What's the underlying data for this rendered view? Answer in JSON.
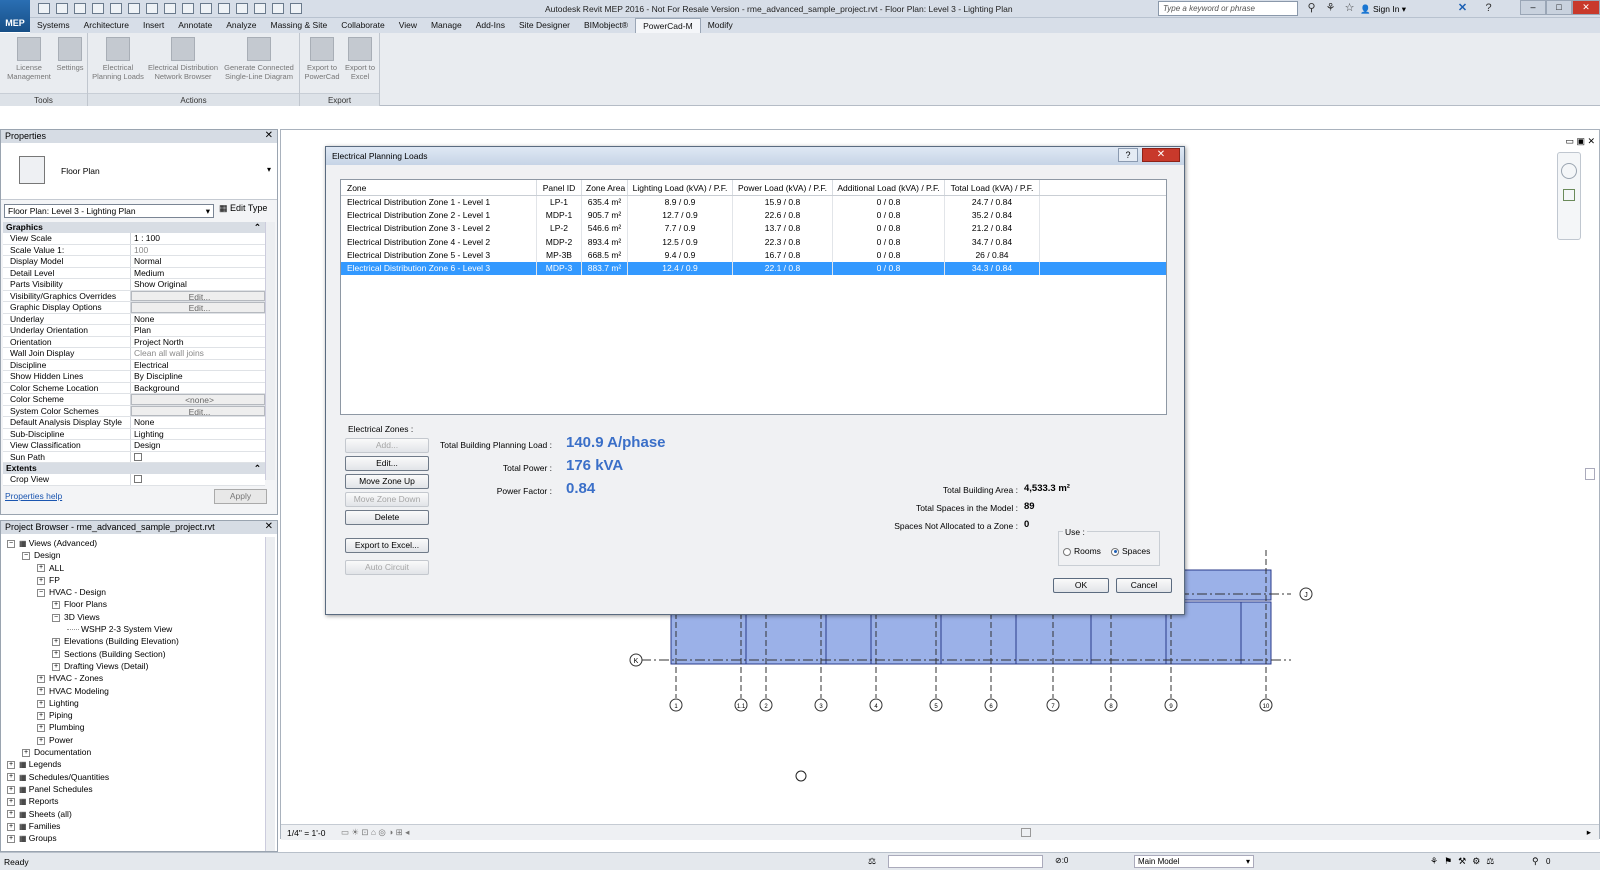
{
  "app": {
    "logo_label": "MEP",
    "title": "Autodesk Revit MEP 2016 - Not For Resale Version -     rme_advanced_sample_project.rvt - Floor Plan: Level 3 - Lighting Plan",
    "search_placeholder": "Type a keyword or phrase",
    "sign_in": "Sign In"
  },
  "tabs": [
    "Systems",
    "Architecture",
    "Insert",
    "Annotate",
    "Analyze",
    "Massing & Site",
    "Collaborate",
    "View",
    "Manage",
    "Add-Ins",
    "Site Designer",
    "BIMobject®",
    "PowerCad-M",
    "Modify"
  ],
  "active_tab": "PowerCad-M",
  "ribbon": {
    "panels": [
      {
        "label": "Tools",
        "buttons": [
          "License\nManagement",
          "Settings"
        ]
      },
      {
        "label": "Actions",
        "buttons": [
          "Electrical\nPlanning Loads",
          "Electrical Distribution\nNetwork Browser",
          "Generate Connected\nSingle-Line Diagram"
        ]
      },
      {
        "label": "Export",
        "buttons": [
          "Export to\nPowerCad",
          "Export to\nExcel"
        ]
      }
    ]
  },
  "properties": {
    "header": "Properties",
    "type_name": "Floor Plan",
    "view_selector": "Floor Plan: Level 3 - Lighting Plan",
    "edit_type": "Edit Type",
    "section_graphics": "Graphics",
    "rows": [
      {
        "k": "View Scale",
        "v": "1 : 100",
        "style": ""
      },
      {
        "k": "Scale Value   1:",
        "v": "100",
        "style": "dim"
      },
      {
        "k": "Display Model",
        "v": "Normal",
        "style": ""
      },
      {
        "k": "Detail Level",
        "v": "Medium",
        "style": ""
      },
      {
        "k": "Parts Visibility",
        "v": "Show Original",
        "style": ""
      },
      {
        "k": "Visibility/Graphics Overrides",
        "v": "Edit...",
        "style": "btn"
      },
      {
        "k": "Graphic Display Options",
        "v": "Edit...",
        "style": "btn"
      },
      {
        "k": "Underlay",
        "v": "None",
        "style": ""
      },
      {
        "k": "Underlay Orientation",
        "v": "Plan",
        "style": ""
      },
      {
        "k": "Orientation",
        "v": "Project North",
        "style": ""
      },
      {
        "k": "Wall Join Display",
        "v": "Clean all wall joins",
        "style": "dim"
      },
      {
        "k": "Discipline",
        "v": "Electrical",
        "style": ""
      },
      {
        "k": "Show Hidden Lines",
        "v": "By Discipline",
        "style": ""
      },
      {
        "k": "Color Scheme Location",
        "v": "Background",
        "style": ""
      },
      {
        "k": "Color Scheme",
        "v": "<none>",
        "style": "btn"
      },
      {
        "k": "System Color Schemes",
        "v": "Edit...",
        "style": "btn"
      },
      {
        "k": "Default Analysis Display Style",
        "v": "None",
        "style": ""
      },
      {
        "k": "Sub-Discipline",
        "v": "Lighting",
        "style": ""
      },
      {
        "k": "View Classification",
        "v": "Design",
        "style": ""
      },
      {
        "k": "Sun Path",
        "v": "",
        "style": "check"
      }
    ],
    "section_extents": "Extents",
    "extent_rows": [
      {
        "k": "Crop View",
        "v": "",
        "style": "check"
      }
    ],
    "help": "Properties help",
    "apply": "Apply"
  },
  "browser": {
    "header": "Project Browser - rme_advanced_sample_project.rvt",
    "items": [
      {
        "label": "Views (Advanced)",
        "level": 0,
        "exp": "-"
      },
      {
        "label": "Design",
        "level": 1,
        "exp": "-"
      },
      {
        "label": "ALL",
        "level": 2,
        "exp": "+"
      },
      {
        "label": "FP",
        "level": 2,
        "exp": "+"
      },
      {
        "label": "HVAC - Design",
        "level": 2,
        "exp": "-"
      },
      {
        "label": "Floor Plans",
        "level": 3,
        "exp": "+"
      },
      {
        "label": "3D Views",
        "level": 3,
        "exp": "-"
      },
      {
        "label": "WSHP 2-3 System View",
        "level": 4,
        "exp": ""
      },
      {
        "label": "Elevations (Building Elevation)",
        "level": 3,
        "exp": "+"
      },
      {
        "label": "Sections (Building Section)",
        "level": 3,
        "exp": "+"
      },
      {
        "label": "Drafting Views (Detail)",
        "level": 3,
        "exp": "+"
      },
      {
        "label": "HVAC - Zones",
        "level": 2,
        "exp": "+"
      },
      {
        "label": "HVAC Modeling",
        "level": 2,
        "exp": "+"
      },
      {
        "label": "Lighting",
        "level": 2,
        "exp": "+"
      },
      {
        "label": "Piping",
        "level": 2,
        "exp": "+"
      },
      {
        "label": "Plumbing",
        "level": 2,
        "exp": "+"
      },
      {
        "label": "Power",
        "level": 2,
        "exp": "+"
      },
      {
        "label": "Documentation",
        "level": 1,
        "exp": "+"
      },
      {
        "label": "Legends",
        "level": 0,
        "exp": "+"
      },
      {
        "label": "Schedules/Quantities",
        "level": 0,
        "exp": "+"
      },
      {
        "label": "Panel Schedules",
        "level": 0,
        "exp": "+"
      },
      {
        "label": "Reports",
        "level": 0,
        "exp": "+"
      },
      {
        "label": "Sheets (all)",
        "level": 0,
        "exp": "+"
      },
      {
        "label": "Families",
        "level": 0,
        "exp": "+"
      },
      {
        "label": "Groups",
        "level": 0,
        "exp": "+"
      }
    ]
  },
  "dialog": {
    "title": "Electrical Planning Loads",
    "columns": [
      "Zone",
      "Panel ID",
      "Zone Area",
      "Lighting Load (kVA) / P.F.",
      "Power Load (kVA) / P.F.",
      "Additional Load (kVA) / P.F.",
      "Total Load (kVA) / P.F."
    ],
    "rows": [
      [
        "Electrical Distribution Zone 1 - Level 1",
        "LP-1",
        "635.4 m²",
        "8.9 / 0.9",
        "15.9 / 0.8",
        "0 / 0.8",
        "24.7 / 0.84"
      ],
      [
        "Electrical Distribution Zone 2 - Level 1",
        "MDP-1",
        "905.7 m²",
        "12.7 / 0.9",
        "22.6 / 0.8",
        "0 / 0.8",
        "35.2 / 0.84"
      ],
      [
        "Electrical Distribution Zone 3 - Level 2",
        "LP-2",
        "546.6 m²",
        "7.7 / 0.9",
        "13.7 / 0.8",
        "0 / 0.8",
        "21.2 / 0.84"
      ],
      [
        "Electrical Distribution Zone 4 - Level 2",
        "MDP-2",
        "893.4 m²",
        "12.5 / 0.9",
        "22.3 / 0.8",
        "0 / 0.8",
        "34.7 / 0.84"
      ],
      [
        "Electrical Distribution Zone 5 - Level 3",
        "MP-3B",
        "668.5 m²",
        "9.4 / 0.9",
        "16.7 / 0.8",
        "0 / 0.8",
        "26 / 0.84"
      ],
      [
        "Electrical Distribution Zone 6 - Level 3",
        "MDP-3",
        "883.7 m²",
        "12.4 / 0.9",
        "22.1 / 0.8",
        "0 / 0.8",
        "34.3 / 0.84"
      ]
    ],
    "selected_row": 5,
    "zones_label": "Electrical Zones :",
    "buttons": {
      "add": "Add...",
      "edit": "Edit...",
      "up": "Move Zone Up",
      "down": "Move Zone Down",
      "delete": "Delete",
      "export": "Export to Excel...",
      "auto": "Auto Circuit"
    },
    "stats": {
      "load_label": "Total Building Planning Load :",
      "load_value": "140.9 A/phase",
      "power_label": "Total Power :",
      "power_value": "176 kVA",
      "pf_label": "Power Factor :",
      "pf_value": "0.84",
      "area_label": "Total Building Area :",
      "area_value": "4,533.3 m²",
      "spaces_label": "Total Spaces in the Model :",
      "spaces_value": "89",
      "unalloc_label": "Spaces Not Allocated to a Zone :",
      "unalloc_value": "0"
    },
    "use_label": "Use :",
    "use_rooms": "Rooms",
    "use_spaces": "Spaces",
    "use_selected": "Spaces",
    "ok": "OK",
    "cancel": "Cancel"
  },
  "plan": {
    "grid_labels": [
      "1",
      "1.1",
      "2",
      "3",
      "4",
      "5",
      "6",
      "7",
      "8",
      "9",
      "10"
    ],
    "side_labels": [
      "K",
      "J"
    ]
  },
  "view_bar": {
    "scale": "1/4\" = 1'-0"
  },
  "status": {
    "text": "Ready",
    "model": "Main Model",
    "filter_count": "0"
  }
}
